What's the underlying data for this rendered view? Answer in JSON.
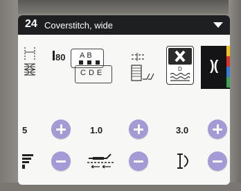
{
  "header": {
    "stitch_number": "24",
    "stitch_name": "Coverstitch, wide"
  },
  "stitch_info": {
    "presser_foot": "80",
    "needle_top": "AB",
    "needle_bottom": "CDE",
    "stabilizer_label": "D"
  },
  "controls": {
    "thread_tension": {
      "value": "5"
    },
    "stitch_length": {
      "value": "1.0"
    },
    "presser_pressure": {
      "value": "3.0"
    }
  },
  "side_tab": {
    "glyph": ")("
  },
  "colors": {
    "button": "#a49ad6",
    "header_bg": "#1e1f21",
    "stripe_yellow": "#f3c21a",
    "stripe_red": "#d8322c",
    "stripe_blue": "#3a7bd5",
    "stripe_green": "#3aa555"
  }
}
